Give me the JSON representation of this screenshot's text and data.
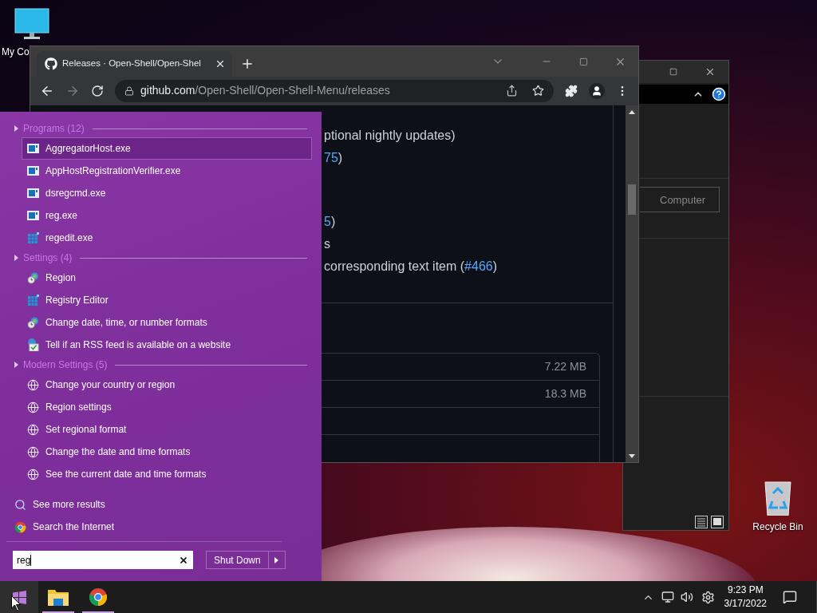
{
  "desktop": {
    "icons": [
      {
        "kind": "computer",
        "label": "My Co"
      },
      {
        "kind": "recycle",
        "label": "Recycle Bin"
      }
    ]
  },
  "back_window": {
    "search": {
      "placeholder": "Computer"
    }
  },
  "browser": {
    "tab": {
      "title": "Releases · Open-Shell/Open-Shel",
      "selected": true
    },
    "nav": {
      "back_enabled": true,
      "forward_enabled": false
    },
    "address": {
      "host": "github.com",
      "path": "/Open-Shell/Open-Shell-Menu/releases"
    },
    "lines": [
      {
        "segments": [
          {
            "text": "ptional nightly updates)",
            "link": false
          }
        ]
      },
      {
        "segments": [
          {
            "text": "75",
            "link": true
          },
          {
            "text": ")",
            "link": false
          }
        ]
      },
      {
        "segments": [
          {
            "text": "5",
            "link": true
          },
          {
            "text": ")",
            "link": false
          }
        ]
      },
      {
        "segments": [
          {
            "text": "s",
            "link": false
          }
        ]
      },
      {
        "segments": [
          {
            "text": "corresponding text item (",
            "link": false
          },
          {
            "text": "#466",
            "link": true
          },
          {
            "text": ")",
            "link": false
          }
        ]
      }
    ],
    "assets": [
      {
        "size": "7.22 MB"
      },
      {
        "size": "18.3 MB"
      }
    ]
  },
  "start_menu": {
    "groups": [
      {
        "title": "Programs (12)",
        "items": [
          {
            "label": "AggregatorHost.exe",
            "kind": "app",
            "selected": true
          },
          {
            "label": "AppHostRegistrationVerifier.exe",
            "kind": "app",
            "selected": false
          },
          {
            "label": "dsregcmd.exe",
            "kind": "app",
            "selected": false
          },
          {
            "label": "reg.exe",
            "kind": "app",
            "selected": false
          },
          {
            "label": "regedit.exe",
            "kind": "regedit",
            "selected": false
          }
        ]
      },
      {
        "title": "Settings (4)",
        "items": [
          {
            "label": "Region",
            "kind": "region",
            "selected": false
          },
          {
            "label": "Registry Editor",
            "kind": "regedit",
            "selected": false
          },
          {
            "label": "Change date, time, or number formats",
            "kind": "region",
            "selected": false
          },
          {
            "label": "Tell if an RSS feed is available on a website",
            "kind": "rss",
            "selected": false
          }
        ]
      },
      {
        "title": "Modern Settings (5)",
        "items": [
          {
            "label": "Change your country or region",
            "kind": "modern",
            "selected": false
          },
          {
            "label": "Region settings",
            "kind": "modern",
            "selected": false
          },
          {
            "label": "Set regional format",
            "kind": "modern",
            "selected": false
          },
          {
            "label": "Change the date and time formats",
            "kind": "modern",
            "selected": false
          },
          {
            "label": "See the current date and time formats",
            "kind": "modern",
            "selected": false
          }
        ]
      }
    ],
    "footer": [
      {
        "label": "See more results",
        "kind": "search"
      },
      {
        "label": "Search the Internet",
        "kind": "chrome"
      }
    ],
    "search": {
      "value": "reg"
    },
    "shutdown": "Shut Down"
  },
  "taskbar": {
    "apps": [
      {
        "kind": "start",
        "selected": true,
        "running": false
      },
      {
        "kind": "explorer",
        "selected": false,
        "running": true
      },
      {
        "kind": "chrome",
        "selected": false,
        "running": true
      }
    ],
    "time": "9:23 PM",
    "date": "3/17/2022"
  }
}
